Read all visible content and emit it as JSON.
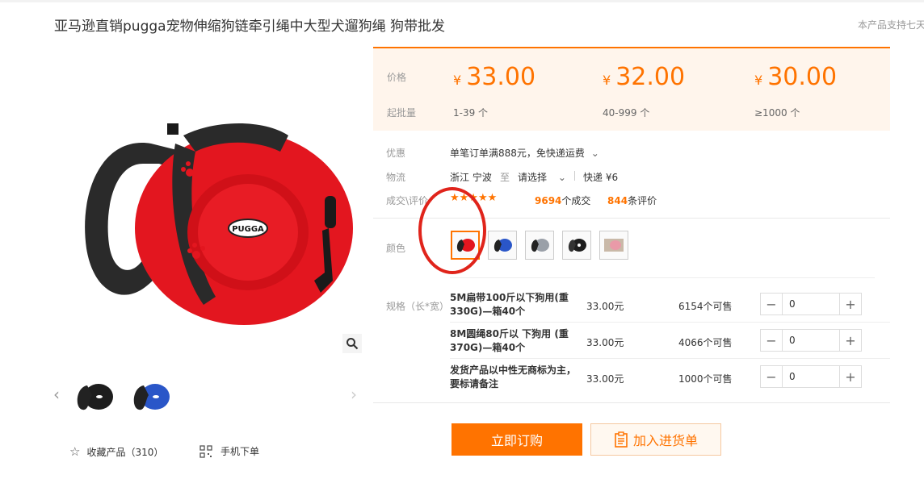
{
  "product": {
    "title": "亚马逊直销pugga宠物伸缩狗链牵引绳中大型犬遛狗绳 狗带批发",
    "support_note": "本产品支持七天",
    "brand_text": "PUGGA"
  },
  "price_table": {
    "price_label": "价格",
    "moq_label": "起批量",
    "currency": "¥",
    "tiers": [
      {
        "price": "33.00",
        "qty": "1-39 个"
      },
      {
        "price": "32.00",
        "qty": "40-999 个"
      },
      {
        "price": "30.00",
        "qty": "≥1000 个"
      }
    ]
  },
  "info": {
    "promo_label": "优惠",
    "promo_text": "单笔订单满888元，免快递运费",
    "logistics_label": "物流",
    "origin": "浙江 宁波",
    "to": "至",
    "dest": "请选择",
    "shipping": "快递 ¥6",
    "deals_label": "成交\\评价",
    "stars": "★★★★★",
    "deals_count": "9694",
    "deals_suffix": "个成交",
    "reviews_count": "844",
    "reviews_suffix": "条评价"
  },
  "color": {
    "label": "颜色",
    "options": [
      "red",
      "blue",
      "gray",
      "black",
      "pink"
    ]
  },
  "specs": {
    "label": "规格（长*宽）",
    "rows": [
      {
        "name": "5M扁带100斤以下狗用(重330G)—箱40个",
        "price": "33.00元",
        "stock": "6154个可售",
        "qty": "0"
      },
      {
        "name": "8M圆绳80斤以 下狗用 (重370G)—箱40个",
        "price": "33.00元",
        "stock": "4066个可售",
        "qty": "0"
      },
      {
        "name": "发货产品以中性无商标为主，要标请备注",
        "price": "33.00元",
        "stock": "1000个可售",
        "qty": "0"
      }
    ]
  },
  "actions": {
    "buy_label": "立即订购",
    "cart_label": "加入进货单",
    "favorite_label": "收藏产品（310）",
    "mobile_label": "手机下单"
  },
  "colors": {
    "accent": "#ff7300",
    "price_bg": "#fff5ec",
    "annotation": "#e0241b"
  }
}
